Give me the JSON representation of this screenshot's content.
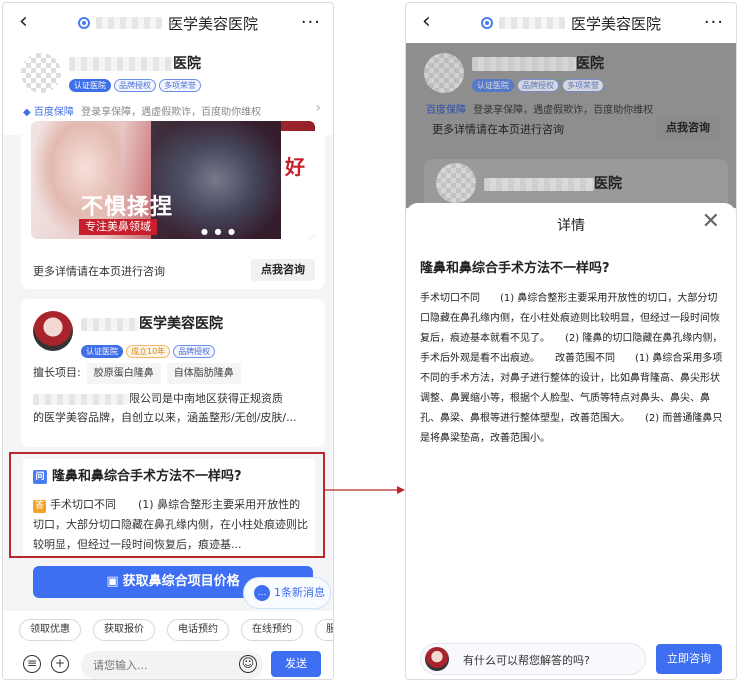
{
  "colors": {
    "accent": "#3e6ef2",
    "highlight_border": "#b82828",
    "badge_gold": "#d68a1a"
  },
  "left": {
    "header": {
      "title": "医学美容医院",
      "back_icon": "‹",
      "more_icon": "···"
    },
    "hospital": {
      "name_suffix": "医院",
      "badges": [
        "认证医院",
        "品牌授权",
        "多项荣誉"
      ],
      "assurance": "百度保障",
      "assurance_text": "登录享保障，遇虚假欺诈，百度助你维权"
    },
    "banner": {
      "big_text": "不惧揉捏",
      "sub_text": "专注美鼻领域",
      "side_text": "好"
    },
    "consult": {
      "text": "更多详情请在本页进行咨询",
      "button": "点我咨询"
    },
    "hospital2": {
      "name": "医学美容医院",
      "badges": [
        "认证医院",
        "成立10年",
        "品牌授权"
      ],
      "specialty_label": "擅长项目:",
      "specialties": [
        "胶原蛋白隆鼻",
        "自体脂肪隆鼻"
      ],
      "desc_line1": "限公司是中南地区获得正规资质",
      "desc_line2": "的医学美容品牌，自创立以来，涵盖整形/无创/皮肤/..."
    },
    "qa": {
      "q_icon": "问",
      "question": "隆鼻和鼻综合手术方法不一样吗?",
      "a_icon": "答",
      "answer": "手术切口不同　　(1) 鼻综合整形主要采用开放性的切口，大部分切口隐藏在鼻孔缘内侧，在小柱处痕迹则比较明显，但经过一段时间恢复后，痕迹基..."
    },
    "cta": "获取鼻综合项目价格",
    "new_msg": "1条新消息",
    "chips": [
      "领取优惠",
      "获取报价",
      "电话预约",
      "在线预约",
      "服"
    ],
    "input": {
      "placeholder": "请您输入...",
      "send": "发送"
    }
  },
  "right": {
    "header": {
      "title": "医学美容医院"
    },
    "dim": {
      "name_suffix": "医院",
      "badges": [
        "认证医院",
        "品牌授权",
        "多项荣誉"
      ],
      "assurance": "百度保障",
      "assurance_text": "登录享保障，遇虚假欺诈，百度助你维权",
      "consult": "更多详情请在本页进行咨询",
      "button": "点我咨询",
      "hosp2_suffix": "医院"
    },
    "sheet": {
      "title": "详情",
      "close_icon": "✕",
      "question": "隆鼻和鼻综合手术方法不一样吗?",
      "answer": "手术切口不同　　(1) 鼻综合整形主要采用开放性的切口，大部分切口隐藏在鼻孔缘内侧，在小柱处痕迹则比较明显，但经过一段时间恢复后，痕迹基本就看不见了。　　(2) 隆鼻的切口隐藏在鼻孔缘内侧，手术后外观是看不出痕迹。　　改善范围不同　　(1) 鼻综合采用多项不同的手术方法，对鼻子进行整体的设计，比如鼻背隆高、鼻尖形状调整、鼻翼缩小等，根据个人脸型、气质等特点对鼻头、鼻尖、鼻孔、鼻梁、鼻根等进行整体塑型，改善范围大。　　(2) 而普通隆鼻只是将鼻梁垫高，改善范围小。",
      "ask_text": "有什么可以帮您解答的吗?",
      "ask_button": "立即咨询"
    }
  }
}
